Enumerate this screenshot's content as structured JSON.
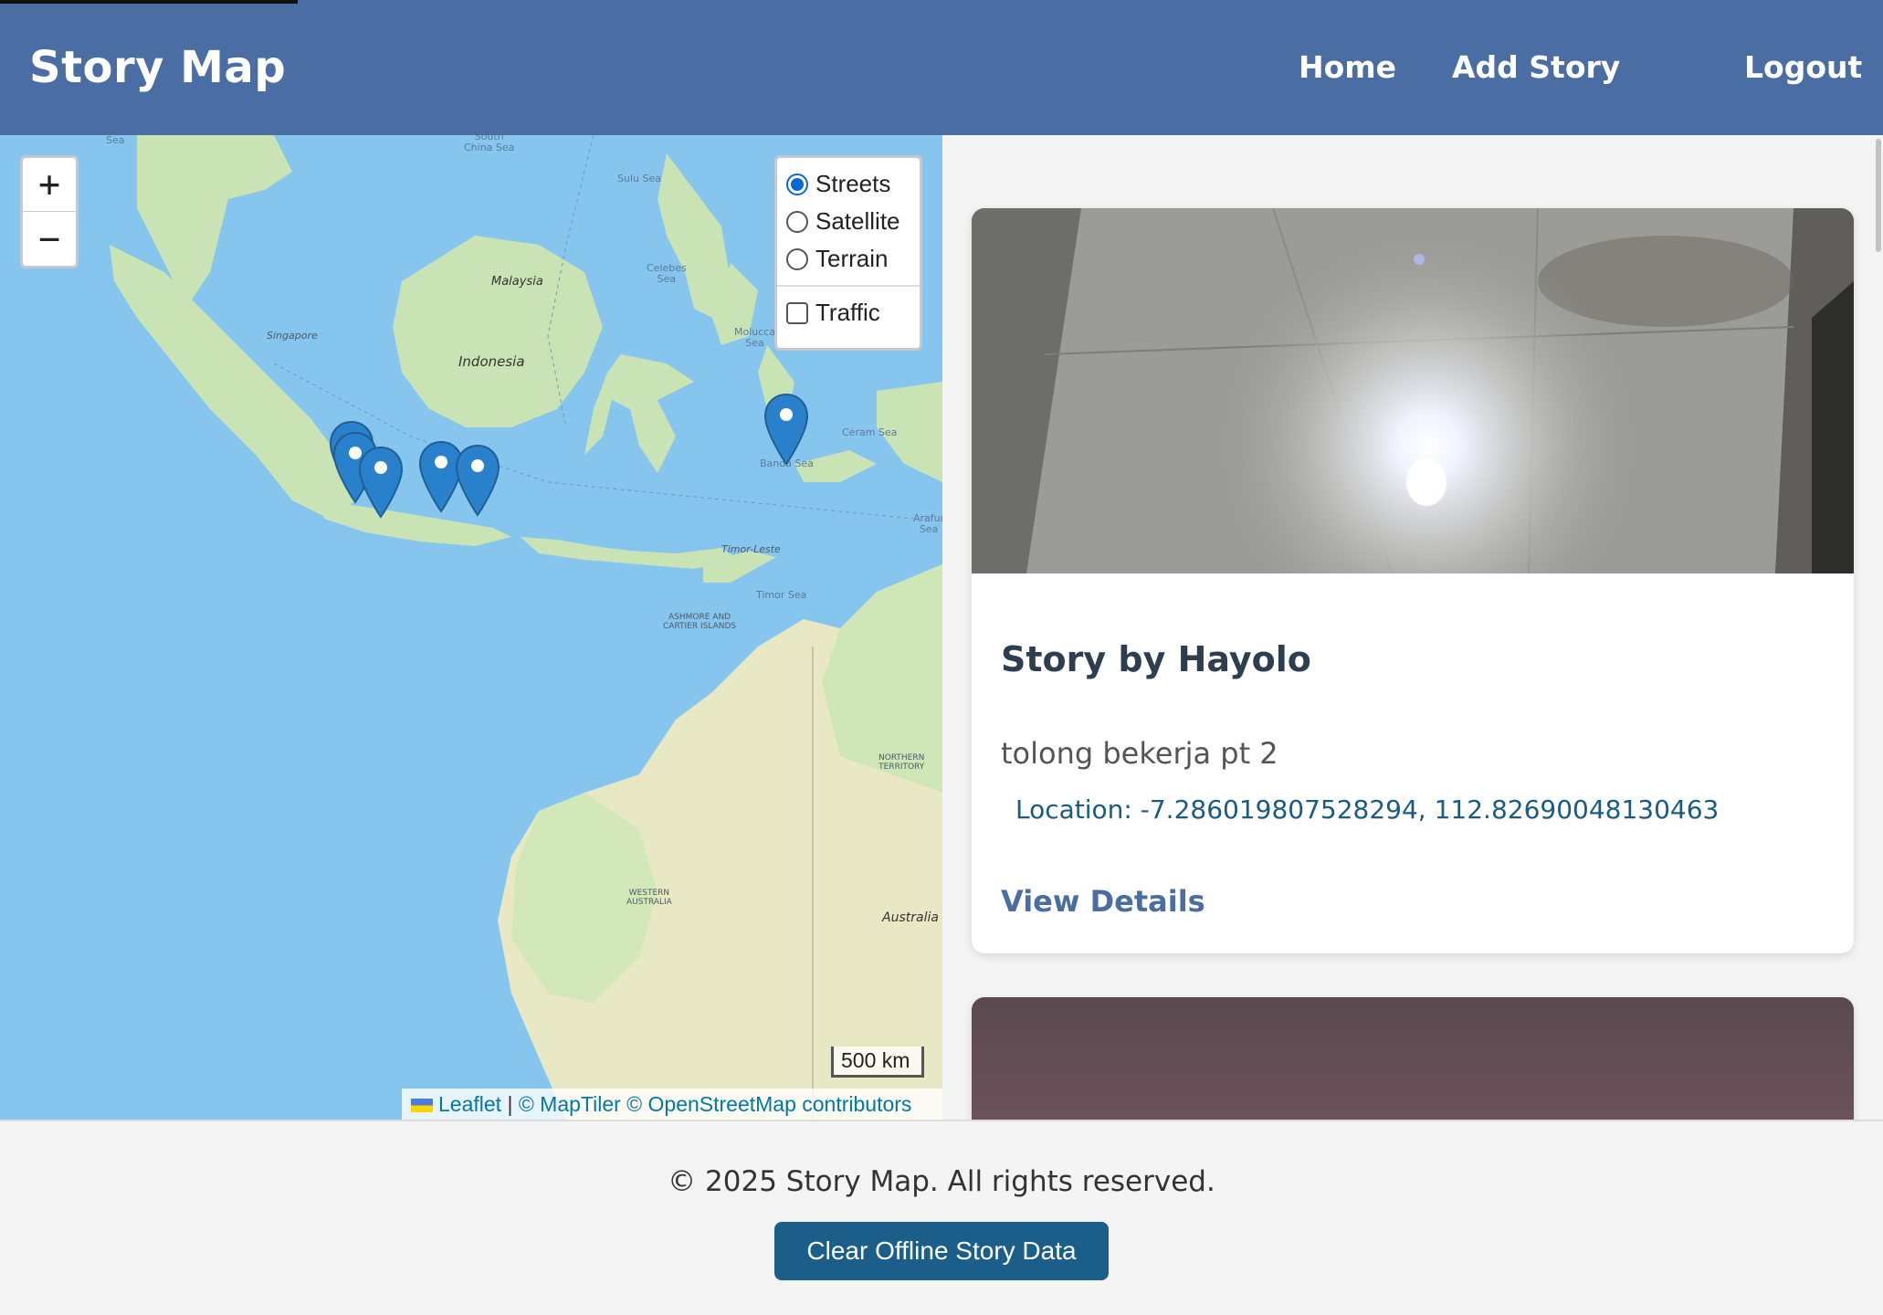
{
  "header": {
    "title": "Story Map",
    "nav": {
      "home": "Home",
      "add_story": "Add Story",
      "logout": "Logout"
    }
  },
  "map": {
    "zoom_in": "+",
    "zoom_out": "−",
    "layers": {
      "streets": "Streets",
      "satellite": "Satellite",
      "terrain": "Terrain",
      "traffic": "Traffic",
      "selected": "Streets",
      "traffic_checked": false
    },
    "scale": "500 km",
    "attribution": {
      "leaflet": "Leaflet",
      "separator": " | ",
      "maptiler": "© MapTiler",
      "osm": "© OpenStreetMap contributors"
    },
    "labels": {
      "sea_top": "Sea",
      "south_china_sea": "South\nChina Sea",
      "sulu_sea": "Sulu Sea",
      "malaysia": "Malaysia",
      "singapore": "Singapore",
      "celebes_sea": "Celebes\nSea",
      "indonesia": "Indonesia",
      "molucca_sea": "Molucca\nSea",
      "ceram_sea": "Ceram Sea",
      "banda_sea": "Banda Sea",
      "arafura_sea": "Arafur\nSea",
      "timor_leste": "Timor-Leste",
      "timor_sea": "Timor Sea",
      "ashmore": "ASHMORE AND\nCARTIER ISLANDS",
      "northern_territory": "NORTHERN\nTERRITORY",
      "western_australia": "WESTERN\nAUSTRALIA",
      "australia": "Australia"
    },
    "marker_color": "#2a81cb"
  },
  "stories": [
    {
      "title": "Story by Hayolo",
      "description": "tolong bekerja pt 2",
      "location": "Location: -7.286019807528294, 112.82690048130463",
      "link": "View Details"
    }
  ],
  "footer": {
    "copyright": "© 2025 Story Map. All rights reserved.",
    "clear_button": "Clear Offline Story Data"
  }
}
